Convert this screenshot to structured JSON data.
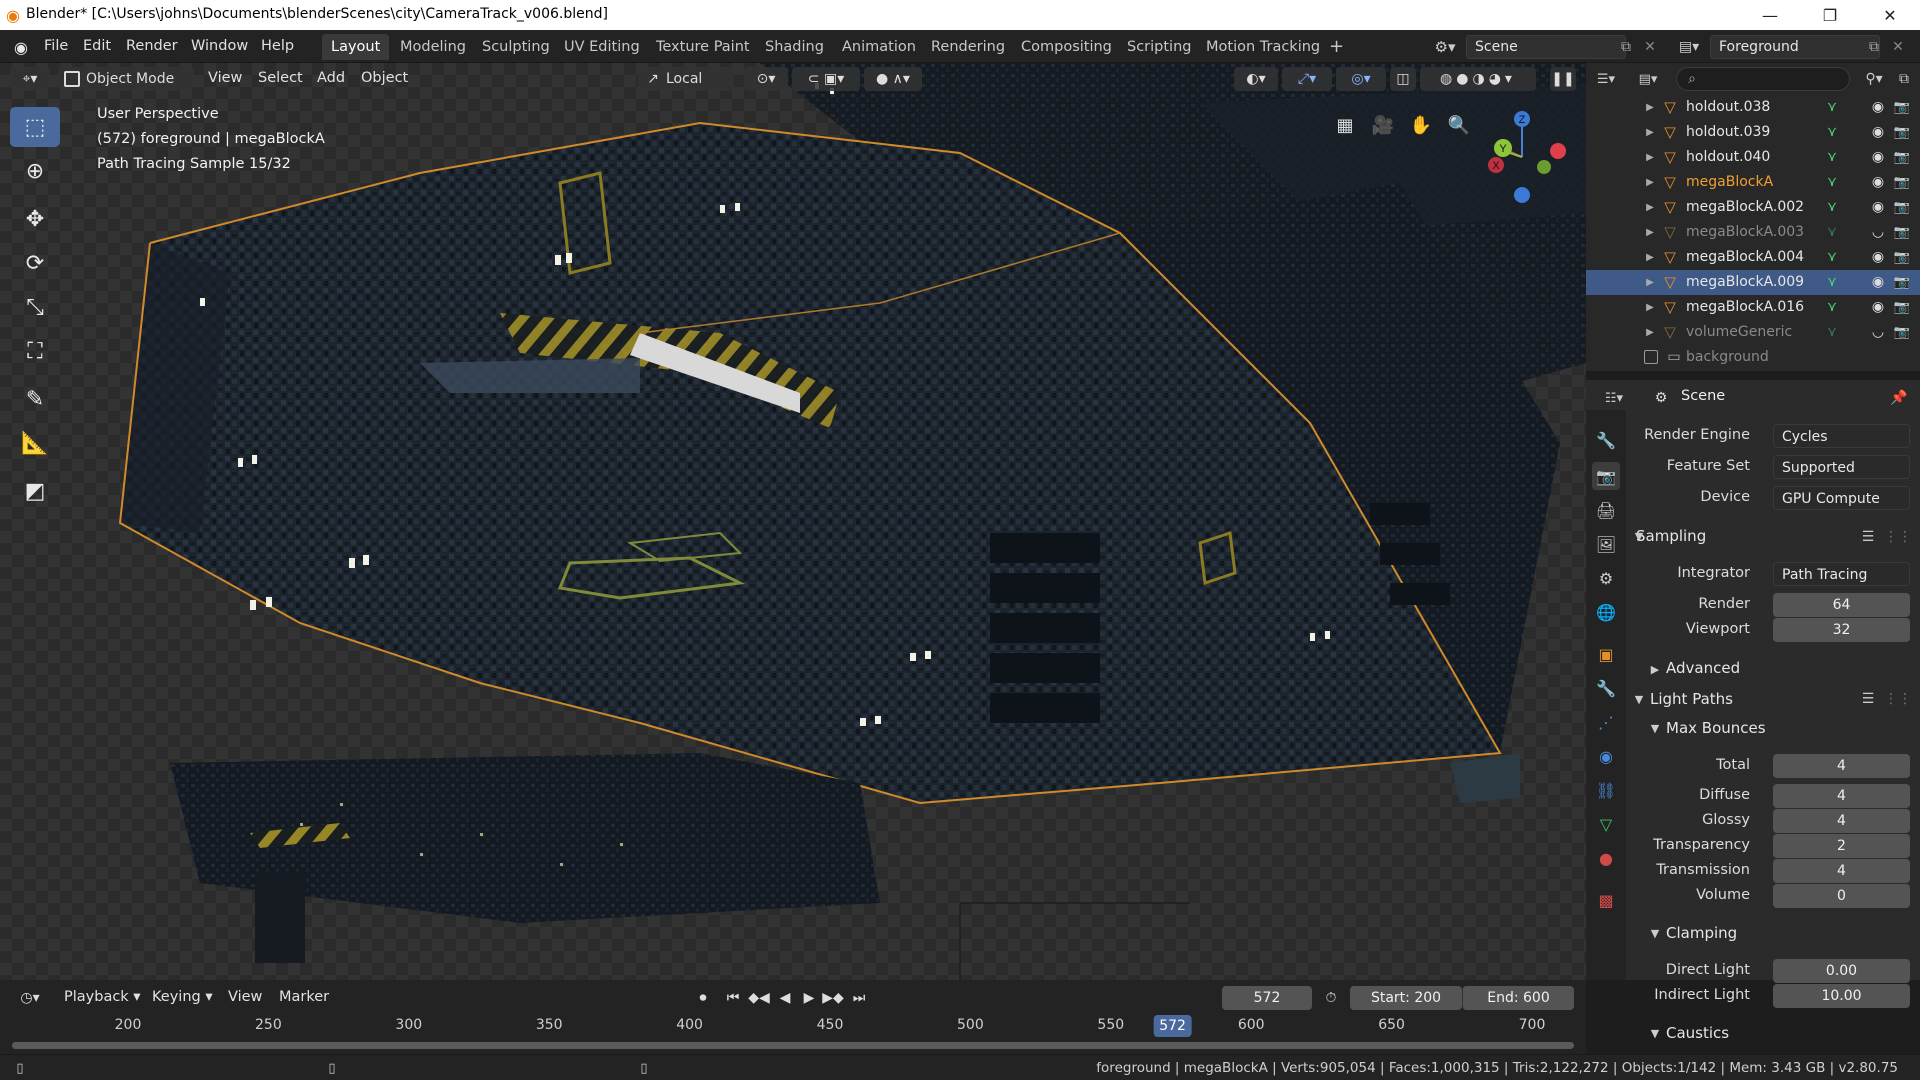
{
  "window": {
    "title": "Blender* [C:\\Users\\johns\\Documents\\blenderScenes\\city\\CameraTrack_v006.blend]",
    "minimize": "—",
    "maximize": "❐",
    "close": "✕"
  },
  "menu": [
    "File",
    "Edit",
    "Render",
    "Window",
    "Help"
  ],
  "workspaces": [
    "Layout",
    "Modeling",
    "Sculpting",
    "UV Editing",
    "Texture Paint",
    "Shading",
    "Animation",
    "Rendering",
    "Compositing",
    "Scripting",
    "Motion Tracking"
  ],
  "workspace_active": "Layout",
  "workspace_add": "+",
  "scene_name": "Scene",
  "view_layer": "Foreground",
  "viewport_header": {
    "mode": "Object Mode",
    "menus": [
      "View",
      "Select",
      "Add",
      "Object"
    ],
    "transform_orientation": "Local"
  },
  "viewport_overlay": {
    "line1": "User Perspective",
    "line2": "(572) foreground | megaBlockA",
    "line3": "Path Tracing Sample 15/32"
  },
  "gizmo": {
    "x": "X",
    "y": "Y",
    "z": "Z"
  },
  "outliner": {
    "rows": [
      {
        "name": "holdout.038",
        "state": "normal"
      },
      {
        "name": "holdout.039",
        "state": "normal"
      },
      {
        "name": "holdout.040",
        "state": "normal"
      },
      {
        "name": "megaBlockA",
        "state": "active"
      },
      {
        "name": "megaBlockA.002",
        "state": "normal"
      },
      {
        "name": "megaBlockA.003",
        "state": "hidden"
      },
      {
        "name": "megaBlockA.004",
        "state": "normal"
      },
      {
        "name": "megaBlockA.009",
        "state": "selected"
      },
      {
        "name": "megaBlockA.016",
        "state": "normal"
      },
      {
        "name": "volumeGeneric",
        "state": "hidden"
      },
      {
        "name": "background",
        "state": "collection"
      }
    ]
  },
  "properties": {
    "context": "Scene",
    "render_engine_label": "Render Engine",
    "render_engine": "Cycles",
    "feature_set_label": "Feature Set",
    "feature_set": "Supported",
    "device_label": "Device",
    "device": "GPU Compute",
    "sampling": "Sampling",
    "integrator_label": "Integrator",
    "integrator": "Path Tracing",
    "render_label": "Render",
    "render_samples": "64",
    "viewport_label": "Viewport",
    "viewport_samples": "32",
    "advanced": "Advanced",
    "light_paths": "Light Paths",
    "max_bounces": "Max Bounces",
    "total_label": "Total",
    "total": "4",
    "diffuse_label": "Diffuse",
    "diffuse": "4",
    "glossy_label": "Glossy",
    "glossy": "4",
    "transparency_label": "Transparency",
    "transparency": "2",
    "transmission_label": "Transmission",
    "transmission": "4",
    "volume_label": "Volume",
    "volume": "0",
    "clamping": "Clamping",
    "direct_light_label": "Direct Light",
    "direct_light": "0.00",
    "indirect_light_label": "Indirect Light",
    "indirect_light": "10.00",
    "caustics": "Caustics"
  },
  "timeline": {
    "menus": [
      "Playback",
      "Keying",
      "View",
      "Marker"
    ],
    "current_frame": "572",
    "start_label": "Start:",
    "start": "200",
    "end_label": "End:",
    "end": "600",
    "ticks": [
      "200",
      "250",
      "300",
      "350",
      "400",
      "450",
      "500",
      "550",
      "600",
      "650",
      "700"
    ],
    "playhead": "572"
  },
  "statusbar": "foreground | megaBlockA | Verts:905,054 | Faces:1,000,315 | Tris:2,122,272 | Objects:1/142 | Mem: 3.43 GB | v2.80.75",
  "colors": {
    "accent": "#4a6a9e",
    "active_object": "#f0a033",
    "selection_row": "#3f5a87",
    "hazard_yellow": "#c8b020"
  }
}
